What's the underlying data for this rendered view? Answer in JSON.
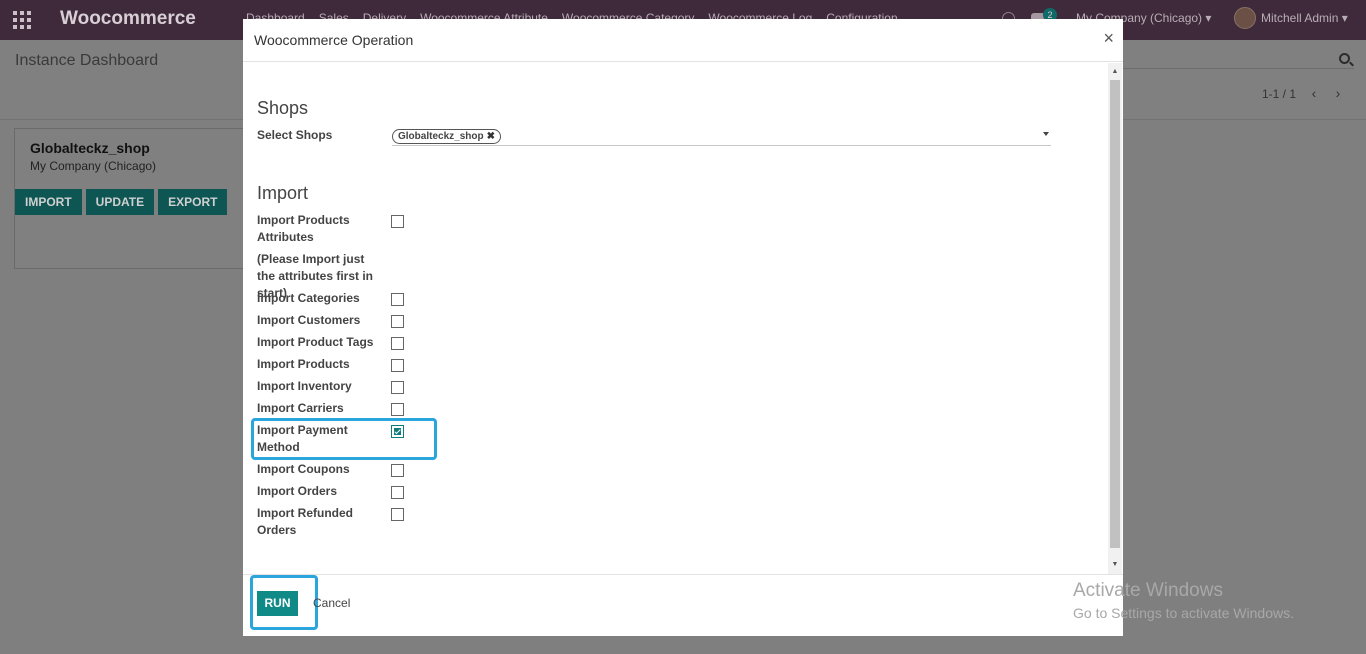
{
  "navbar": {
    "brand": "Woocommerce",
    "menu": [
      "Dashboard",
      "Sales",
      "Delivery",
      "Woocommerce Attribute",
      "Woocommerce Category",
      "Woocommerce Log",
      "Configuration"
    ],
    "chat_count": "2",
    "company": "My Company (Chicago)",
    "user": "Mitchell Admin"
  },
  "control_panel": {
    "breadcrumb": "Instance Dashboard",
    "pager": "1-1 / 1"
  },
  "kanban": {
    "shop_name": "Globalteckz_shop",
    "company": "My Company (Chicago)",
    "buttons": [
      "IMPORT",
      "UPDATE",
      "EXPORT"
    ]
  },
  "modal": {
    "title": "Woocommerce Operation",
    "close": "×",
    "shops_section": "Shops",
    "select_shops_label": "Select Shops",
    "selected_shop_tag": "Globalteckz_shop",
    "import_section": "Import",
    "fields": [
      {
        "label": "Import Products Attributes",
        "checked": false
      },
      {
        "label": "(Please Import just the attributes first in start)"
      },
      {
        "label": "Import Categories",
        "checked": false
      },
      {
        "label": "Import Customers",
        "checked": false
      },
      {
        "label": "Import Product Tags",
        "checked": false
      },
      {
        "label": "Import Products",
        "checked": false
      },
      {
        "label": "Import Inventory",
        "checked": false
      },
      {
        "label": "Import Carriers",
        "checked": false
      },
      {
        "label": "Import Payment Method",
        "checked": true
      },
      {
        "label": "Import Coupons",
        "checked": false
      },
      {
        "label": "Import Orders",
        "checked": false
      },
      {
        "label": "Import Refunded Orders",
        "checked": false
      }
    ],
    "run_label": "RUN",
    "cancel_label": "Cancel"
  },
  "watermark": {
    "title": "Activate Windows",
    "subtitle": "Go to Settings to activate Windows."
  },
  "colors": {
    "navbar": "#3e2a3a",
    "primary": "#0f8a86",
    "highlight": "#2aa6dd"
  }
}
